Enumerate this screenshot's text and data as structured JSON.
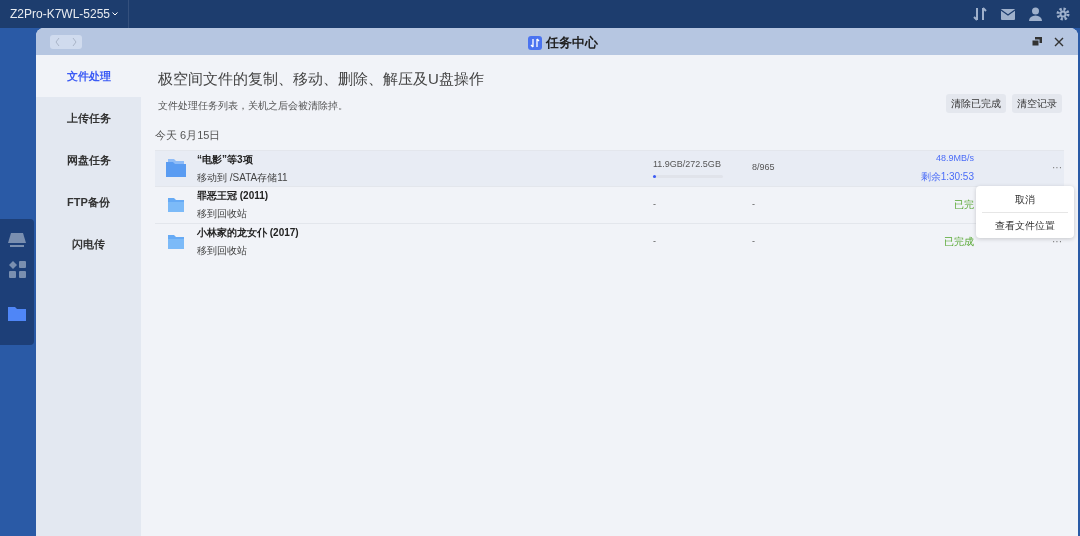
{
  "top_bar": {
    "device": "Z2Pro-K7WL-5255"
  },
  "dock": {
    "items": [
      {
        "kind": "drive",
        "selected": false
      },
      {
        "kind": "apps",
        "selected": false
      },
      {
        "kind": "folder",
        "selected": true
      }
    ]
  },
  "window": {
    "title": "任务中心"
  },
  "sidebar": {
    "items": [
      {
        "label": "文件处理",
        "selected": true
      },
      {
        "label": "上传任务",
        "selected": false
      },
      {
        "label": "网盘任务",
        "selected": false
      },
      {
        "label": "FTP备份",
        "selected": false
      },
      {
        "label": "闪电传",
        "selected": false
      }
    ]
  },
  "heading": "极空间文件的复制、移动、删除、解压及U盘操作",
  "subtitle": "文件处理任务列表，关机之后会被清除掉。",
  "buttons": [
    "清除已完成",
    "清空记录"
  ],
  "date_group": "今天 6月15日",
  "tasks": [
    {
      "kind": "running",
      "name": "“电影”等3项",
      "action": "移动到 /SATA存储11",
      "size": "11.9GB/272.5GB",
      "level": 0.04,
      "count": "8/965",
      "speed": "48.9MB/s",
      "remaining": "剩余1:30:53",
      "more": "···",
      "highlighted": true
    },
    {
      "kind": "done",
      "name": "罪恶王冠 (2011)",
      "action": "移到回收站",
      "size": "-",
      "count": "-",
      "status": "已完",
      "highlighted": false
    },
    {
      "kind": "done",
      "name": "小林家的龙女仆 (2017)",
      "action": "移到回收站",
      "size": "-",
      "count": "-",
      "status": "已完成",
      "more": "···",
      "highlighted": false
    }
  ],
  "context_menu": [
    "取消",
    "查看文件位置"
  ]
}
